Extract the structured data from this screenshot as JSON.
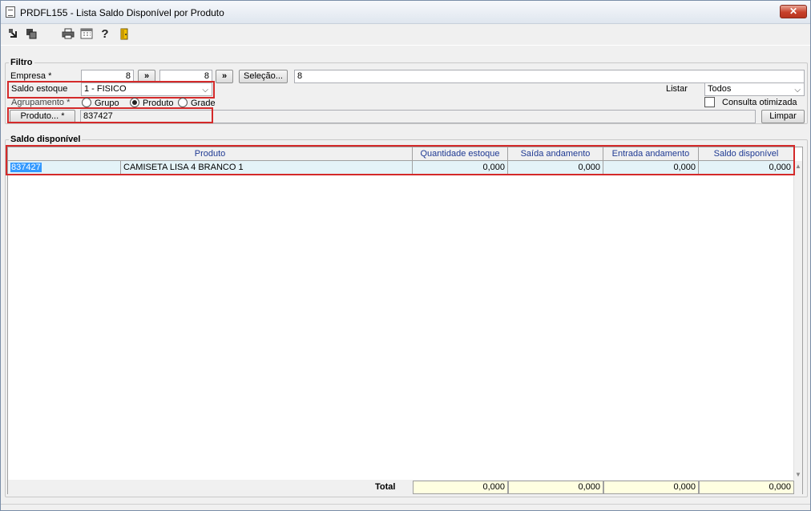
{
  "window": {
    "title": "PRDFL155 - Lista Saldo Disponível por Produto",
    "close_label": "✕"
  },
  "toolbar": {
    "icons": [
      "export-icon",
      "copy-icon",
      "print-icon",
      "calendar-icon",
      "help-icon",
      "exit-door-icon"
    ]
  },
  "filtro": {
    "title": "Filtro",
    "empresa_label": "Empresa *",
    "empresa_from": "8",
    "empresa_to": "8",
    "arrow_label": "»",
    "selecao_label": "Seleção...",
    "selecao_value": "8",
    "saldo_estoque_label": "Saldo estoque",
    "saldo_estoque_value": "1 - FISICO",
    "listar_label": "Listar",
    "listar_value": "Todos",
    "consulta_label": "Consulta otimizada",
    "agrupamento_label": "Agrupamento *",
    "agrupamento_options": [
      "Grupo",
      "Produto",
      "Grade"
    ],
    "agrupamento_selected": "Produto",
    "produto_button": "Produto... *",
    "produto_value": "837427",
    "limpar_label": "Limpar"
  },
  "saldo": {
    "title": "Saldo disponível",
    "columns": [
      "Produto",
      "Quantidade estoque",
      "Saída andamento",
      "Entrada andamento",
      "Saldo disponível"
    ],
    "rows": [
      {
        "codigo": "837427",
        "descricao": "CAMISETA LISA 4 BRANCO 1",
        "quantidade": "0,000",
        "saida": "0,000",
        "entrada": "0,000",
        "saldo": "0,000"
      }
    ],
    "total_label": "Total",
    "totals": [
      "0,000",
      "0,000",
      "0,000",
      "0,000"
    ]
  },
  "colors": {
    "highlight": "#d42a2a",
    "selection": "#3399ff",
    "header_text": "#1f3a93"
  }
}
